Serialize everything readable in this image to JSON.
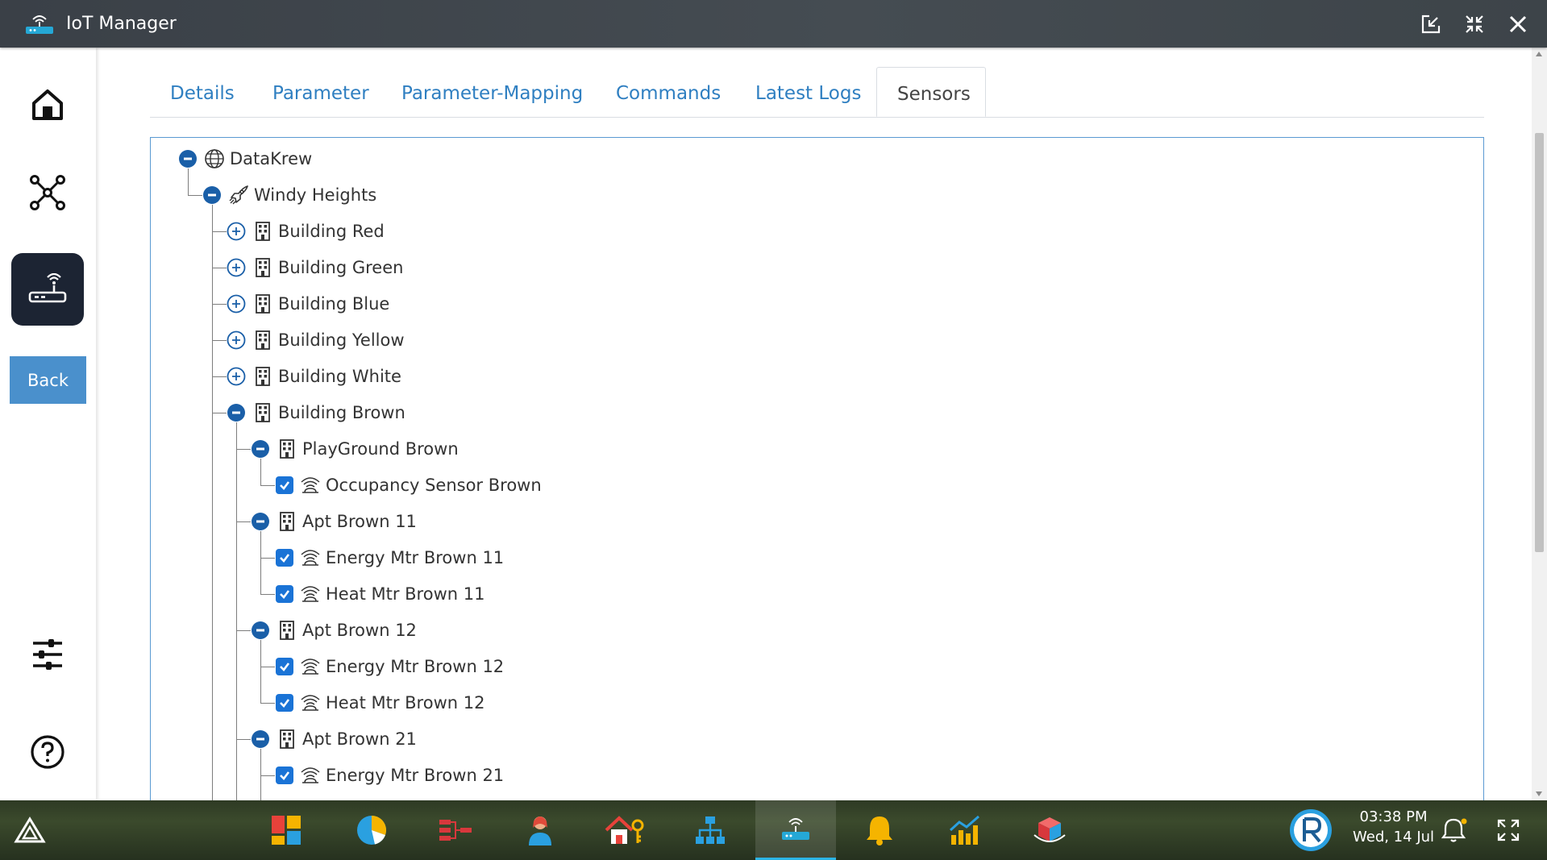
{
  "window": {
    "title": "IoT Manager",
    "controls": [
      "popout-icon",
      "collapse-icon",
      "close-icon"
    ]
  },
  "sidebar": {
    "items": [
      {
        "name": "home",
        "icon": "home-icon",
        "active": false
      },
      {
        "name": "network",
        "icon": "network-icon",
        "active": false
      },
      {
        "name": "iot-device",
        "icon": "router-icon",
        "active": true
      }
    ],
    "back_label": "Back",
    "bottom_items": [
      {
        "name": "settings",
        "icon": "sliders-icon"
      },
      {
        "name": "help",
        "icon": "help-icon"
      }
    ]
  },
  "tabs": [
    {
      "label": "Details",
      "active": false
    },
    {
      "label": "Parameter",
      "active": false
    },
    {
      "label": "Parameter-Mapping",
      "active": false
    },
    {
      "label": "Commands",
      "active": false
    },
    {
      "label": "Latest Logs",
      "active": false
    },
    {
      "label": "Sensors",
      "active": true
    }
  ],
  "tree": [
    {
      "label": "DataKrew",
      "icon": "globe-icon",
      "state": "expanded",
      "level": 0
    },
    {
      "label": "Windy Heights",
      "icon": "rocket-icon",
      "state": "expanded",
      "level": 1
    },
    {
      "label": "Building Red",
      "icon": "building-icon",
      "state": "collapsed",
      "level": 2
    },
    {
      "label": "Building Green",
      "icon": "building-icon",
      "state": "collapsed",
      "level": 2
    },
    {
      "label": "Building Blue",
      "icon": "building-icon",
      "state": "collapsed",
      "level": 2
    },
    {
      "label": "Building Yellow",
      "icon": "building-icon",
      "state": "collapsed",
      "level": 2
    },
    {
      "label": "Building White",
      "icon": "building-icon",
      "state": "collapsed",
      "level": 2
    },
    {
      "label": "Building Brown",
      "icon": "building-icon",
      "state": "expanded",
      "level": 2
    },
    {
      "label": "PlayGround Brown",
      "icon": "building-icon",
      "state": "expanded",
      "level": 3
    },
    {
      "label": "Occupancy Sensor Brown",
      "icon": "sensor-icon",
      "state": "checked",
      "level": 4
    },
    {
      "label": "Apt Brown 11",
      "icon": "building-icon",
      "state": "expanded",
      "level": 3
    },
    {
      "label": "Energy Mtr Brown 11",
      "icon": "sensor-icon",
      "state": "checked",
      "level": 4
    },
    {
      "label": "Heat Mtr Brown 11",
      "icon": "sensor-icon",
      "state": "checked",
      "level": 4
    },
    {
      "label": "Apt Brown 12",
      "icon": "building-icon",
      "state": "expanded",
      "level": 3
    },
    {
      "label": "Energy Mtr Brown 12",
      "icon": "sensor-icon",
      "state": "checked",
      "level": 4
    },
    {
      "label": "Heat Mtr Brown 12",
      "icon": "sensor-icon",
      "state": "checked",
      "level": 4
    },
    {
      "label": "Apt Brown 21",
      "icon": "building-icon",
      "state": "expanded",
      "level": 3
    },
    {
      "label": "Energy Mtr Brown 21",
      "icon": "sensor-icon",
      "state": "checked",
      "level": 4
    }
  ],
  "taskbar": {
    "apps": [
      {
        "name": "start",
        "icon": "triangle-logo-icon"
      },
      {
        "name": "dashboard",
        "icon": "dashboard-tiles-icon"
      },
      {
        "name": "analytics",
        "icon": "pie-chart-icon"
      },
      {
        "name": "flow",
        "icon": "flow-icon"
      },
      {
        "name": "users",
        "icon": "user-icon"
      },
      {
        "name": "access",
        "icon": "home-key-icon"
      },
      {
        "name": "hierarchy",
        "icon": "hierarchy-icon"
      },
      {
        "name": "iot-manager",
        "icon": "router-icon",
        "active": true
      },
      {
        "name": "alerts",
        "icon": "bell-icon"
      },
      {
        "name": "reports",
        "icon": "bar-chart-icon"
      },
      {
        "name": "3d",
        "icon": "cube-icon"
      }
    ],
    "time": "03:38 PM",
    "date": "Wed, 14 Jul",
    "tray": [
      "profile-logo-icon",
      "notification-icon",
      "fullscreen-icon"
    ]
  },
  "colors": {
    "accent": "#2f7fc1",
    "active_sidebar": "#1c2433",
    "back_button": "#4a90cc",
    "toggle": "#1a5fa8",
    "checkbox": "#1a73d6",
    "tree_border": "#5a9ad2"
  }
}
